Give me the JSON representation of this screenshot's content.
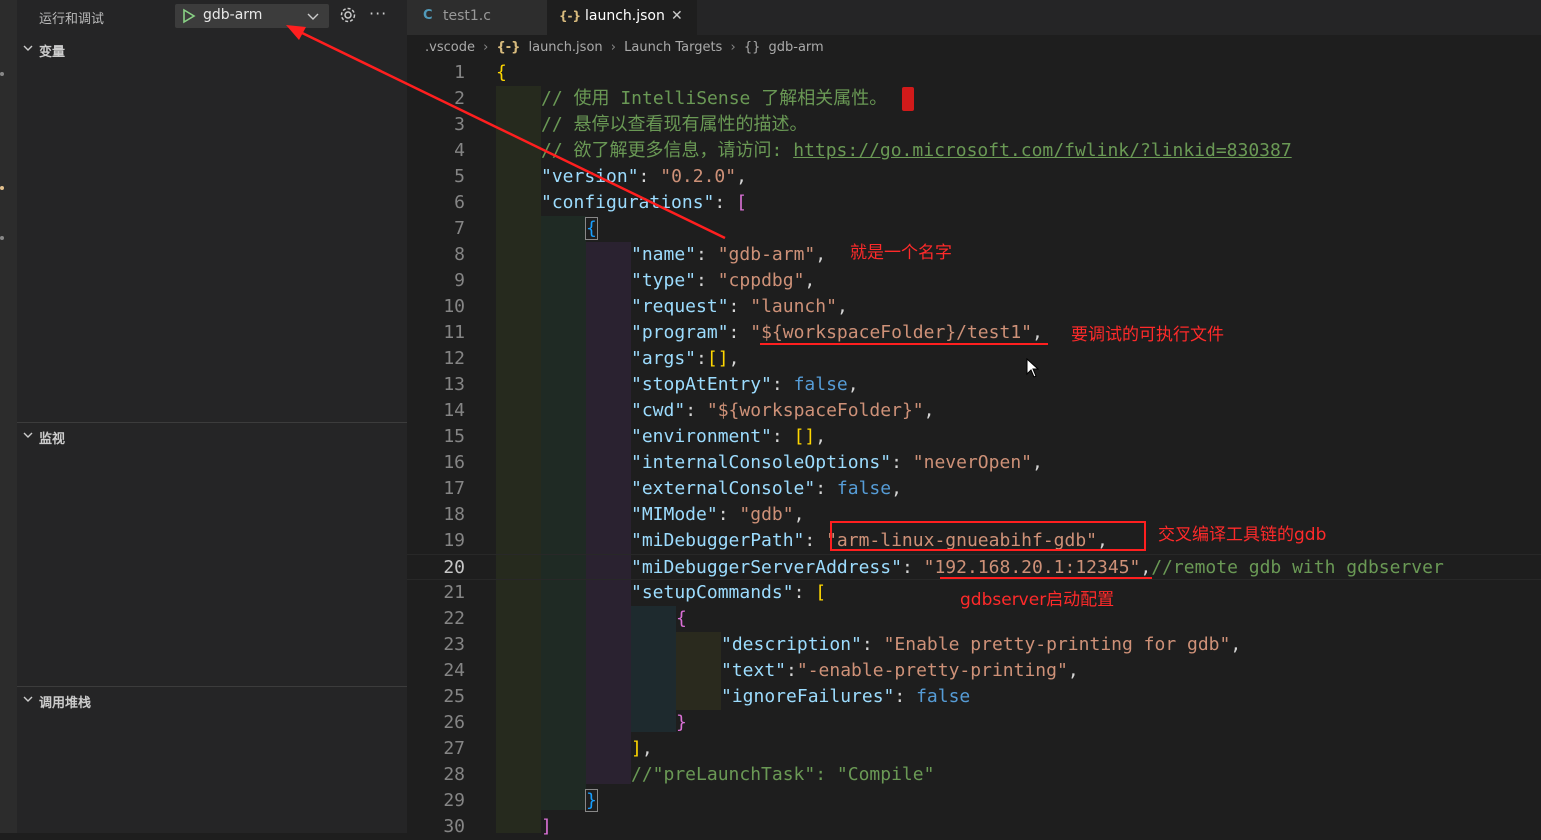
{
  "sidebar": {
    "title": "运行和调试",
    "launch_config": "gdb-arm",
    "sections": {
      "variables": "变量",
      "watch": "监视",
      "call_stack": "调用堆栈"
    }
  },
  "tabs": [
    {
      "icon": "C",
      "label": "test1.c"
    },
    {
      "icon": "{-}",
      "label": "launch.json",
      "close": "✕"
    }
  ],
  "breadcrumb": {
    "folder": ".vscode",
    "file": "launch.json",
    "section": "Launch Targets",
    "item": "gdb-arm"
  },
  "editor": {
    "active_line": 20,
    "line_numbers": [
      "1",
      "2",
      "3",
      "4",
      "5",
      "6",
      "7",
      "8",
      "9",
      "10",
      "11",
      "12",
      "13",
      "14",
      "15",
      "16",
      "17",
      "18",
      "19",
      "20",
      "21",
      "22",
      "23",
      "24",
      "25",
      "26",
      "27",
      "28",
      "29",
      "30"
    ],
    "code": {
      "l2": "// 使用 IntelliSense 了解相关属性。",
      "l3": "// 悬停以查看现有属性的描述。",
      "l4_prefix": "// 欲了解更多信息，请访问: ",
      "l4_url": "https://go.microsoft.com/fwlink/?linkid=830387",
      "version_key": "\"version\"",
      "version_val": "\"0.2.0\"",
      "configurations_key": "\"configurations\"",
      "name_key": "\"name\"",
      "name_val": "\"gdb-arm\"",
      "type_key": "\"type\"",
      "type_val": "\"cppdbg\"",
      "request_key": "\"request\"",
      "request_val": "\"launch\"",
      "program_key": "\"program\"",
      "program_val": "\"${workspaceFolder}/test1\"",
      "args_key": "\"args\"",
      "stopAtEntry_key": "\"stopAtEntry\"",
      "stopAtEntry_val": "false",
      "cwd_key": "\"cwd\"",
      "cwd_val": "\"${workspaceFolder}\"",
      "environment_key": "\"environment\"",
      "internalConsoleOptions_key": "\"internalConsoleOptions\"",
      "internalConsoleOptions_val": "\"neverOpen\"",
      "externalConsole_key": "\"externalConsole\"",
      "externalConsole_val": "false",
      "MIMode_key": "\"MIMode\"",
      "MIMode_val": "\"gdb\"",
      "miDebuggerPath_key": "\"miDebuggerPath\"",
      "miDebuggerPath_val": "\"arm-linux-gnueabihf-gdb\"",
      "miDebuggerServerAddress_key": "\"miDebuggerServerAddress\"",
      "miDebuggerServerAddress_val": "\"192.168.20.1:12345\"",
      "l20_comment": "//remote gdb with gdbserver",
      "setupCommands_key": "\"setupCommands\"",
      "description_key": "\"description\"",
      "description_val": "\"Enable pretty-printing for gdb\"",
      "text_key": "\"text\"",
      "text_val": "\"-enable-pretty-printing\"",
      "ignoreFailures_key": "\"ignoreFailures\"",
      "ignoreFailures_val": "false",
      "l28_comment": "//\"preLaunchTask\": \"Compile\""
    }
  },
  "annotations": {
    "name_note": "就是一个名字",
    "program_note": "要调试的可执行文件",
    "debugger_note": "交叉编译工具链的gdb",
    "server_note": "gdbserver启动配置"
  },
  "colors": {
    "annotation": "#ff1f1f",
    "string": "#ce9178",
    "key": "#9cdcfe",
    "comment": "#6a9955",
    "keyword": "#569cd6"
  }
}
